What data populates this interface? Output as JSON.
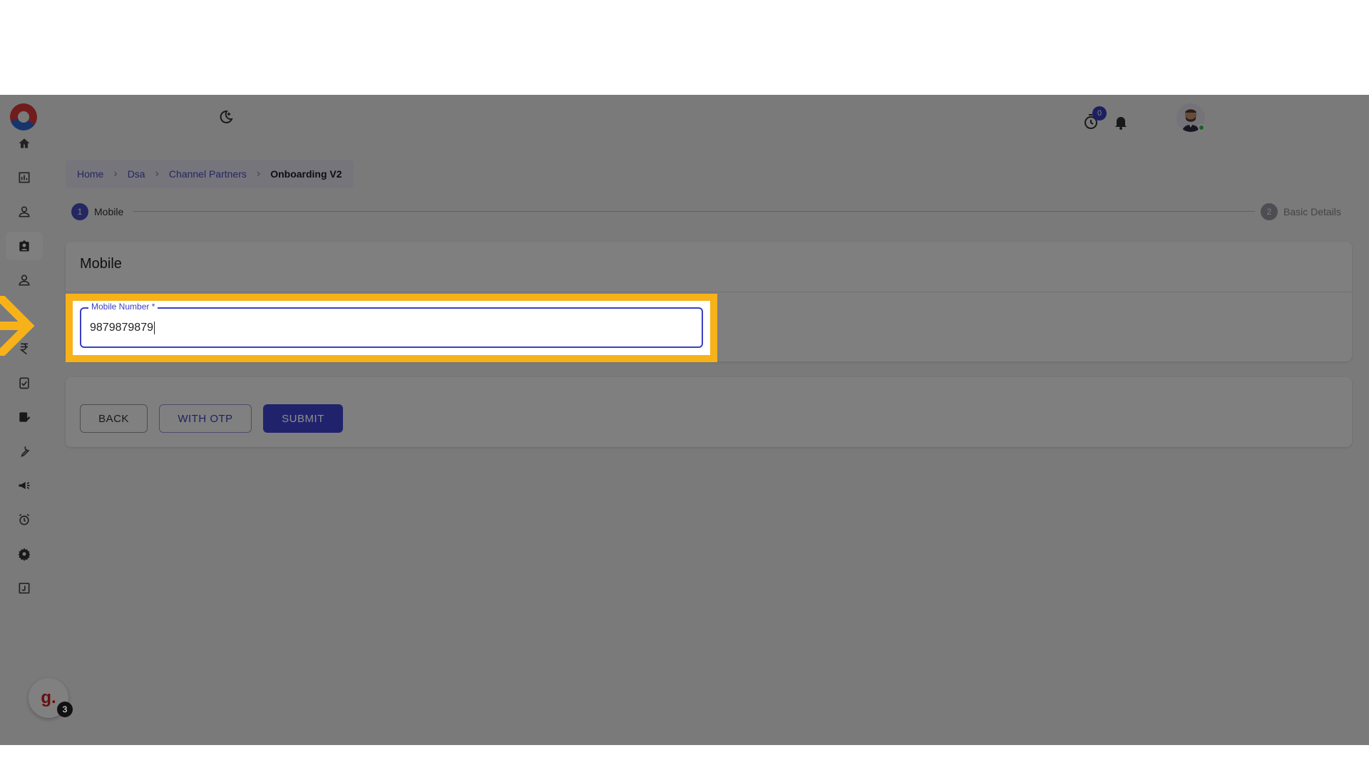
{
  "breadcrumb": {
    "items": [
      "Home",
      "Dsa",
      "Channel Partners"
    ],
    "current": "Onboarding V2"
  },
  "stepper": {
    "steps": [
      {
        "number": "1",
        "label": "Mobile",
        "state": "active"
      },
      {
        "number": "2",
        "label": "Basic Details",
        "state": "pending"
      }
    ]
  },
  "form": {
    "card_title": "Mobile",
    "mobile_field": {
      "label": "Mobile Number *",
      "value": "9879879879"
    }
  },
  "actions": {
    "back_label": "BACK",
    "otp_label": "WITH OTP",
    "submit_label": "SUBMIT"
  },
  "header": {
    "timer_badge_count": "0"
  },
  "floating": {
    "logo_text": "g.",
    "count": "3"
  },
  "icons": {
    "sidebar": [
      "home-icon",
      "dashboard-icon",
      "user-icon",
      "badge-icon",
      "person-icon",
      "rupee-icon",
      "clipboard-check-icon",
      "form-edit-icon",
      "wrench-icon",
      "megaphone-icon",
      "alarm-icon",
      "gear-icon",
      "journal-icon"
    ],
    "header": [
      "dark-mode-icon",
      "timer-icon",
      "bell-icon"
    ]
  },
  "colors": {
    "primary": "#3b3fc4",
    "highlight": "#f7b21a",
    "overlay": "rgba(0,0,0,0.5)"
  }
}
